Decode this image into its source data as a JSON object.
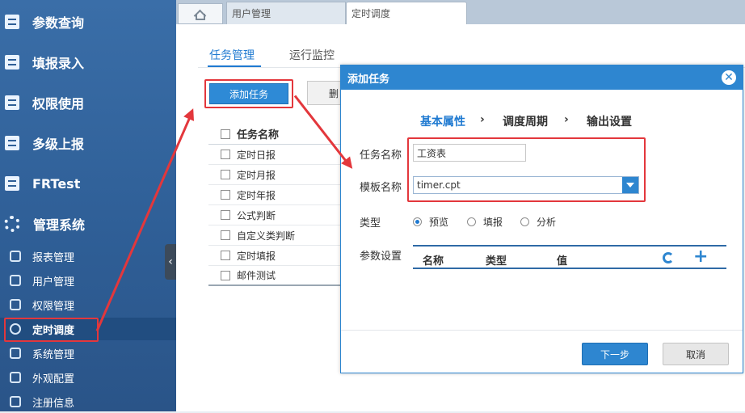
{
  "sidebar": {
    "menus": [
      {
        "label": "参数查询",
        "icon": "report-icon"
      },
      {
        "label": "填报录入",
        "icon": "report-icon"
      },
      {
        "label": "权限使用",
        "icon": "report-icon"
      },
      {
        "label": "多级上报",
        "icon": "report-icon"
      },
      {
        "label": "FRTest",
        "icon": "report-icon"
      },
      {
        "label": "管理系统",
        "icon": "gear-icon"
      }
    ],
    "submenus": [
      {
        "label": "报表管理",
        "icon": "report-manage-icon"
      },
      {
        "label": "用户管理",
        "icon": "user-icon"
      },
      {
        "label": "权限管理",
        "icon": "lock-icon"
      },
      {
        "label": "定时调度",
        "icon": "clock-icon",
        "active": true
      },
      {
        "label": "系统管理",
        "icon": "gear-icon"
      },
      {
        "label": "外观配置",
        "icon": "brush-icon"
      },
      {
        "label": "注册信息",
        "icon": "registration-icon"
      }
    ],
    "collapse_glyph": "‹"
  },
  "tabs": [
    {
      "label": "用户管理"
    },
    {
      "label": "定时调度"
    }
  ],
  "content": {
    "subtabs": [
      "任务管理",
      "运行监控"
    ],
    "add_button": "添加任务",
    "delete_button": "删",
    "task_header": "任务名称",
    "tasks": [
      "定时日报",
      "定时月报",
      "定时年报",
      "公式判断",
      "自定义类判断",
      "定时填报",
      "邮件测试"
    ]
  },
  "dialog": {
    "title": "添加任务",
    "close_glyph": "✕",
    "steps": [
      "基本属性",
      "调度周期",
      "输出设置"
    ],
    "step_separator": "›",
    "labels": {
      "task_name": "任务名称",
      "template_name": "模板名称",
      "type": "类型",
      "params": "参数设置"
    },
    "task_name_value": "工资表",
    "template_value": "timer.cpt",
    "type_options": [
      "预览",
      "填报",
      "分析"
    ],
    "selected_type": "预览",
    "param_columns": [
      "名称",
      "类型",
      "值"
    ],
    "plus_glyph": "+",
    "next_button": "下一步",
    "cancel_button": "取消"
  },
  "colors": {
    "accent": "#2e86d0",
    "annotation_red": "#e3373c",
    "sidebar": "#2f5f97"
  }
}
